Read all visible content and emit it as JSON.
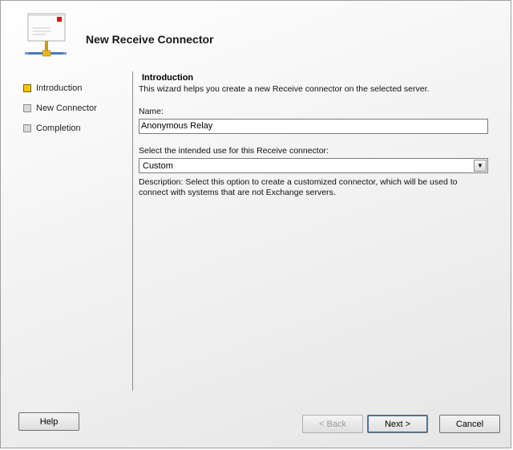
{
  "window": {
    "title": "New Receive Connector"
  },
  "nav": {
    "items": [
      {
        "label": "Introduction",
        "state": "active"
      },
      {
        "label": "New Connector",
        "state": "pending"
      },
      {
        "label": "Completion",
        "state": "pending"
      }
    ]
  },
  "content": {
    "section_title": "Introduction",
    "section_description": "This wizard helps you create a new Receive connector on the selected server.",
    "name_label": "Name:",
    "name_value": "Anonymous Relay",
    "usage_label": "Select the intended use for this Receive connector:",
    "usage_value": "Custom",
    "usage_description": "Description: Select this option to create a customized connector, which will be used to connect with systems that are not Exchange servers."
  },
  "buttons": {
    "help": "Help",
    "back": "< Back",
    "next": "Next >",
    "cancel": "Cancel"
  },
  "colors": {
    "active_step": "#f5c400",
    "pending_step": "#d8d8d8"
  }
}
